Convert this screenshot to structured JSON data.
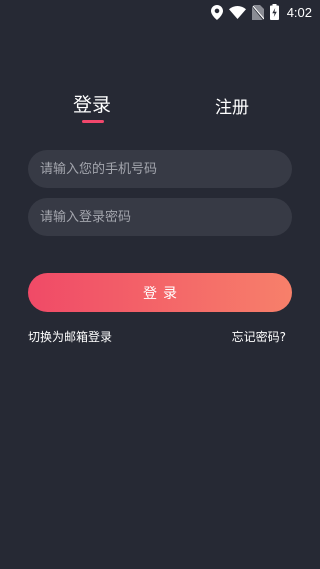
{
  "status_bar": {
    "time": "4:02",
    "icons": [
      "location-icon",
      "wifi-icon",
      "no-sim-icon",
      "battery-charging-icon"
    ]
  },
  "tabs": [
    {
      "label": "登录",
      "active": true
    },
    {
      "label": "注册",
      "active": false
    }
  ],
  "form": {
    "phone_placeholder": "请输入您的手机号码",
    "code_placeholder": "请输入登录密码"
  },
  "login_button_label": "登录",
  "links": {
    "email_login": "切换为邮箱登录",
    "forgot_password": "忘记密码?"
  },
  "colors": {
    "background": "#262934",
    "input_background": "#373a45",
    "accent": "#f2476c",
    "button_gradient_start": "#f04a67",
    "button_gradient_end": "#f7806a"
  }
}
